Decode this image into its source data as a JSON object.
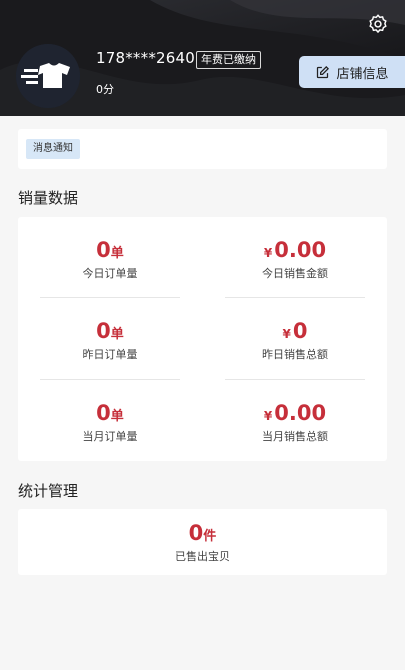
{
  "header": {
    "phone": "178****2640",
    "paid_badge": "年费已缴纳",
    "score": "0分",
    "shop_button": "店铺信息"
  },
  "notice": {
    "tag": "消息通知"
  },
  "sales": {
    "title": "销量数据",
    "metrics": [
      {
        "value": "0",
        "unit": "单",
        "label": "今日订单量"
      },
      {
        "currency": "¥",
        "value": "0.00",
        "label": "今日销售金额"
      },
      {
        "value": "0",
        "unit": "单",
        "label": "昨日订单量"
      },
      {
        "currency": "¥",
        "value": "0",
        "label": "昨日销售总额"
      },
      {
        "value": "0",
        "unit": "单",
        "label": "当月订单量"
      },
      {
        "currency": "¥",
        "value": "0.00",
        "label": "当月销售总额"
      }
    ]
  },
  "stats": {
    "title": "统计管理",
    "sold": {
      "value": "0",
      "unit": "件",
      "label": "已售出宝贝"
    }
  },
  "colors": {
    "accent_red": "#c62f3a",
    "header_bg": "#1c1c1f",
    "shop_button_bg": "#cfe0f5",
    "notice_tag_bg": "#d7e7f7"
  }
}
